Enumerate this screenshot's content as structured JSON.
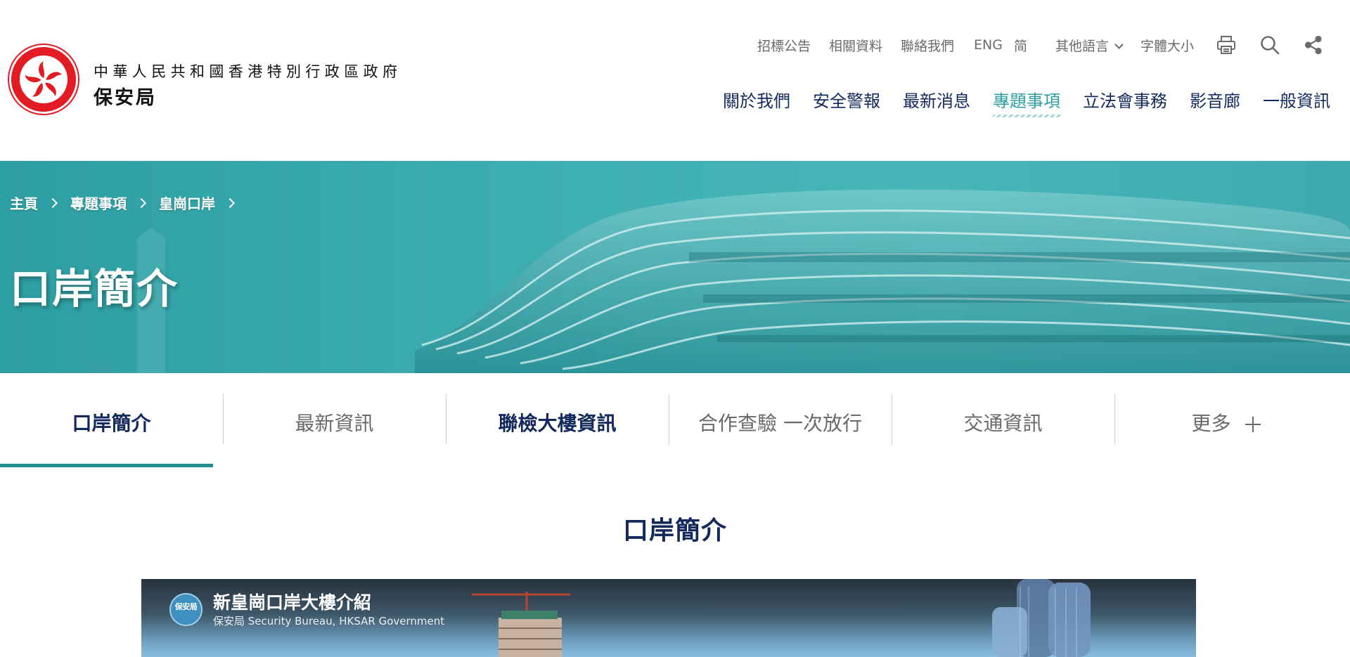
{
  "header": {
    "dept_top": "中華人民共和國香港特別行政區政府",
    "dept_main": "保安局",
    "utility_links": [
      "招標公告",
      "相關資料",
      "聯絡我們"
    ],
    "lang_eng": "ENG",
    "lang_simplified": "简",
    "other_languages": "其他語言",
    "font_size": "字體大小",
    "nav": [
      "關於我們",
      "安全警報",
      "最新消息",
      "專題事項",
      "立法會事務",
      "影音廊",
      "一般資訊"
    ],
    "active_nav": "專題事項"
  },
  "banner": {
    "breadcrumb": [
      "主頁",
      "專題事項",
      "皇崗口岸"
    ],
    "title": "口岸簡介"
  },
  "tabs": {
    "items": [
      "口岸簡介",
      "最新資訊",
      "聯檢大樓資訊",
      "合作查驗 一次放行",
      "交通資訊",
      "更多"
    ],
    "active": "口岸簡介"
  },
  "section": {
    "title": "口岸簡介"
  },
  "video": {
    "avatar_text": "保安局",
    "title": "新皇崗口岸大樓介紹",
    "channel": "保安局 Security Bureau, HKSAR Government"
  },
  "colors": {
    "navy": "#13295c",
    "teal": "#2a9da2",
    "tab_underline": "#1f8f95",
    "emblem_red": "#e31b23"
  },
  "icons": [
    "hk-emblem-icon",
    "chevron-down-icon",
    "print-icon",
    "search-icon",
    "share-icon",
    "chevron-right-icon",
    "plus-icon"
  ]
}
